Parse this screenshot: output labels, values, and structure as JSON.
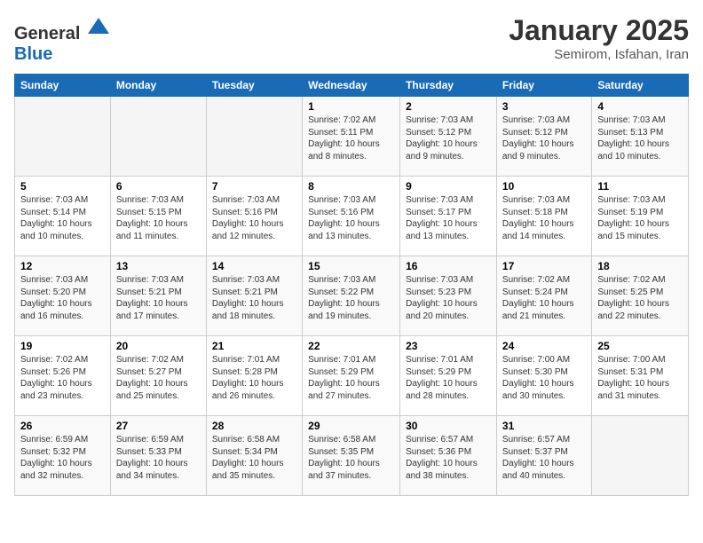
{
  "header": {
    "logo_general": "General",
    "logo_blue": "Blue",
    "title": "January 2025",
    "subtitle": "Semirom, Isfahan, Iran"
  },
  "days_of_week": [
    "Sunday",
    "Monday",
    "Tuesday",
    "Wednesday",
    "Thursday",
    "Friday",
    "Saturday"
  ],
  "weeks": [
    [
      {
        "day": "",
        "info": ""
      },
      {
        "day": "",
        "info": ""
      },
      {
        "day": "",
        "info": ""
      },
      {
        "day": "1",
        "info": "Sunrise: 7:02 AM\nSunset: 5:11 PM\nDaylight: 10 hours and 8 minutes."
      },
      {
        "day": "2",
        "info": "Sunrise: 7:03 AM\nSunset: 5:12 PM\nDaylight: 10 hours and 9 minutes."
      },
      {
        "day": "3",
        "info": "Sunrise: 7:03 AM\nSunset: 5:12 PM\nDaylight: 10 hours and 9 minutes."
      },
      {
        "day": "4",
        "info": "Sunrise: 7:03 AM\nSunset: 5:13 PM\nDaylight: 10 hours and 10 minutes."
      }
    ],
    [
      {
        "day": "5",
        "info": "Sunrise: 7:03 AM\nSunset: 5:14 PM\nDaylight: 10 hours and 10 minutes."
      },
      {
        "day": "6",
        "info": "Sunrise: 7:03 AM\nSunset: 5:15 PM\nDaylight: 10 hours and 11 minutes."
      },
      {
        "day": "7",
        "info": "Sunrise: 7:03 AM\nSunset: 5:16 PM\nDaylight: 10 hours and 12 minutes."
      },
      {
        "day": "8",
        "info": "Sunrise: 7:03 AM\nSunset: 5:16 PM\nDaylight: 10 hours and 13 minutes."
      },
      {
        "day": "9",
        "info": "Sunrise: 7:03 AM\nSunset: 5:17 PM\nDaylight: 10 hours and 13 minutes."
      },
      {
        "day": "10",
        "info": "Sunrise: 7:03 AM\nSunset: 5:18 PM\nDaylight: 10 hours and 14 minutes."
      },
      {
        "day": "11",
        "info": "Sunrise: 7:03 AM\nSunset: 5:19 PM\nDaylight: 10 hours and 15 minutes."
      }
    ],
    [
      {
        "day": "12",
        "info": "Sunrise: 7:03 AM\nSunset: 5:20 PM\nDaylight: 10 hours and 16 minutes."
      },
      {
        "day": "13",
        "info": "Sunrise: 7:03 AM\nSunset: 5:21 PM\nDaylight: 10 hours and 17 minutes."
      },
      {
        "day": "14",
        "info": "Sunrise: 7:03 AM\nSunset: 5:21 PM\nDaylight: 10 hours and 18 minutes."
      },
      {
        "day": "15",
        "info": "Sunrise: 7:03 AM\nSunset: 5:22 PM\nDaylight: 10 hours and 19 minutes."
      },
      {
        "day": "16",
        "info": "Sunrise: 7:03 AM\nSunset: 5:23 PM\nDaylight: 10 hours and 20 minutes."
      },
      {
        "day": "17",
        "info": "Sunrise: 7:02 AM\nSunset: 5:24 PM\nDaylight: 10 hours and 21 minutes."
      },
      {
        "day": "18",
        "info": "Sunrise: 7:02 AM\nSunset: 5:25 PM\nDaylight: 10 hours and 22 minutes."
      }
    ],
    [
      {
        "day": "19",
        "info": "Sunrise: 7:02 AM\nSunset: 5:26 PM\nDaylight: 10 hours and 23 minutes."
      },
      {
        "day": "20",
        "info": "Sunrise: 7:02 AM\nSunset: 5:27 PM\nDaylight: 10 hours and 25 minutes."
      },
      {
        "day": "21",
        "info": "Sunrise: 7:01 AM\nSunset: 5:28 PM\nDaylight: 10 hours and 26 minutes."
      },
      {
        "day": "22",
        "info": "Sunrise: 7:01 AM\nSunset: 5:29 PM\nDaylight: 10 hours and 27 minutes."
      },
      {
        "day": "23",
        "info": "Sunrise: 7:01 AM\nSunset: 5:29 PM\nDaylight: 10 hours and 28 minutes."
      },
      {
        "day": "24",
        "info": "Sunrise: 7:00 AM\nSunset: 5:30 PM\nDaylight: 10 hours and 30 minutes."
      },
      {
        "day": "25",
        "info": "Sunrise: 7:00 AM\nSunset: 5:31 PM\nDaylight: 10 hours and 31 minutes."
      }
    ],
    [
      {
        "day": "26",
        "info": "Sunrise: 6:59 AM\nSunset: 5:32 PM\nDaylight: 10 hours and 32 minutes."
      },
      {
        "day": "27",
        "info": "Sunrise: 6:59 AM\nSunset: 5:33 PM\nDaylight: 10 hours and 34 minutes."
      },
      {
        "day": "28",
        "info": "Sunrise: 6:58 AM\nSunset: 5:34 PM\nDaylight: 10 hours and 35 minutes."
      },
      {
        "day": "29",
        "info": "Sunrise: 6:58 AM\nSunset: 5:35 PM\nDaylight: 10 hours and 37 minutes."
      },
      {
        "day": "30",
        "info": "Sunrise: 6:57 AM\nSunset: 5:36 PM\nDaylight: 10 hours and 38 minutes."
      },
      {
        "day": "31",
        "info": "Sunrise: 6:57 AM\nSunset: 5:37 PM\nDaylight: 10 hours and 40 minutes."
      },
      {
        "day": "",
        "info": ""
      }
    ]
  ]
}
